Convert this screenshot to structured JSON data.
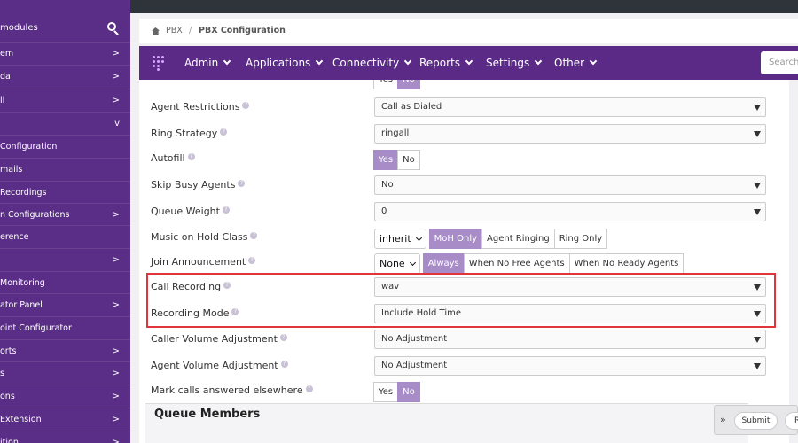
{
  "sidebar": {
    "search_label": "modules",
    "items": [
      {
        "label": "em",
        "chevron": ">"
      },
      {
        "label": "da",
        "chevron": ">"
      },
      {
        "label": "ll",
        "chevron": ">"
      },
      {
        "label": "",
        "chevron": "v"
      },
      {
        "label": "Configuration",
        "chevron": ""
      },
      {
        "label": "mails",
        "chevron": ""
      },
      {
        "label": "Recordings",
        "chevron": ""
      },
      {
        "label": "n Configurations",
        "chevron": ">"
      },
      {
        "label": "erence",
        "chevron": ""
      },
      {
        "label": "",
        "chevron": ">"
      },
      {
        "label": "Monitoring",
        "chevron": ""
      },
      {
        "label": "ator Panel",
        "chevron": ">"
      },
      {
        "label": "oint Configurator",
        "chevron": ""
      },
      {
        "label": "orts",
        "chevron": ">"
      },
      {
        "label": "s",
        "chevron": ">"
      },
      {
        "label": "ons",
        "chevron": ">"
      },
      {
        "label": "Extension",
        "chevron": ">"
      },
      {
        "label": "ition",
        "chevron": ">"
      }
    ]
  },
  "breadcrumb": {
    "home": "PBX",
    "separator": "/",
    "current": "PBX Configuration"
  },
  "navbar": {
    "items": [
      "Admin",
      "Applications",
      "Connectivity",
      "Reports",
      "Settings",
      "Other"
    ],
    "search_placeholder": "Search"
  },
  "form": {
    "partial_row": {
      "yes": "Yes",
      "no": "No"
    },
    "agent_restrictions": {
      "label": "Agent Restrictions",
      "value": "Call as Dialed"
    },
    "ring_strategy": {
      "label": "Ring Strategy",
      "value": "ringall"
    },
    "autofill": {
      "label": "Autofill",
      "yes": "Yes",
      "no": "No",
      "selected": "Yes"
    },
    "skip_busy_agents": {
      "label": "Skip Busy Agents",
      "value": "No"
    },
    "queue_weight": {
      "label": "Queue Weight",
      "value": "0"
    },
    "music_on_hold": {
      "label": "Music on Hold Class",
      "class_value": "inherit",
      "options": [
        "MoH Only",
        "Agent Ringing",
        "Ring Only"
      ],
      "selected": "MoH Only"
    },
    "join_announcement": {
      "label": "Join Announcement",
      "value": "None",
      "options": [
        "Always",
        "When No Free Agents",
        "When No Ready Agents"
      ],
      "selected": "Always"
    },
    "call_recording": {
      "label": "Call Recording",
      "value": "wav"
    },
    "recording_mode": {
      "label": "Recording Mode",
      "value": "Include Hold Time"
    },
    "caller_volume": {
      "label": "Caller Volume Adjustment",
      "value": "No Adjustment"
    },
    "agent_volume": {
      "label": "Agent Volume Adjustment",
      "value": "No Adjustment"
    },
    "mark_calls": {
      "label": "Mark calls answered elsewhere",
      "yes": "Yes",
      "no": "No",
      "selected": "No"
    }
  },
  "section": {
    "title": "Queue Members"
  },
  "footer": {
    "toggle": "»",
    "submit": "Submit",
    "reset": "R"
  },
  "colors": {
    "accent": "#5b2a86",
    "active": "#a78cc8",
    "highlight": "#e0353a"
  }
}
